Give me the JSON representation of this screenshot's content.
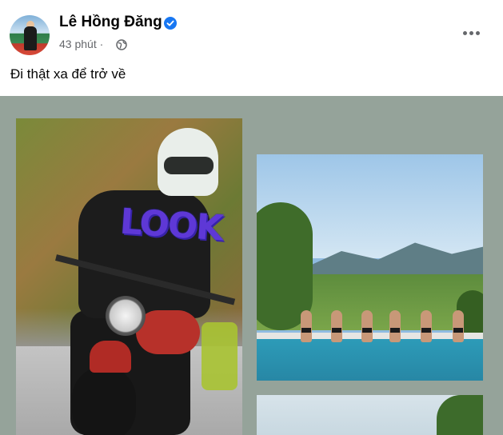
{
  "post": {
    "author_name": "Lê Hồng Đăng",
    "time": "43 phút ·",
    "caption": "Đi thật xa để trở về"
  },
  "icons": {
    "verified": "verified-badge-icon",
    "audience": "globe-icon",
    "more": "more-options-icon"
  },
  "photos": {
    "photo_1": {
      "sticker_text": "LOOK"
    }
  },
  "colors": {
    "verified_blue": "#1877f2",
    "grid_background": "#95a39a"
  }
}
